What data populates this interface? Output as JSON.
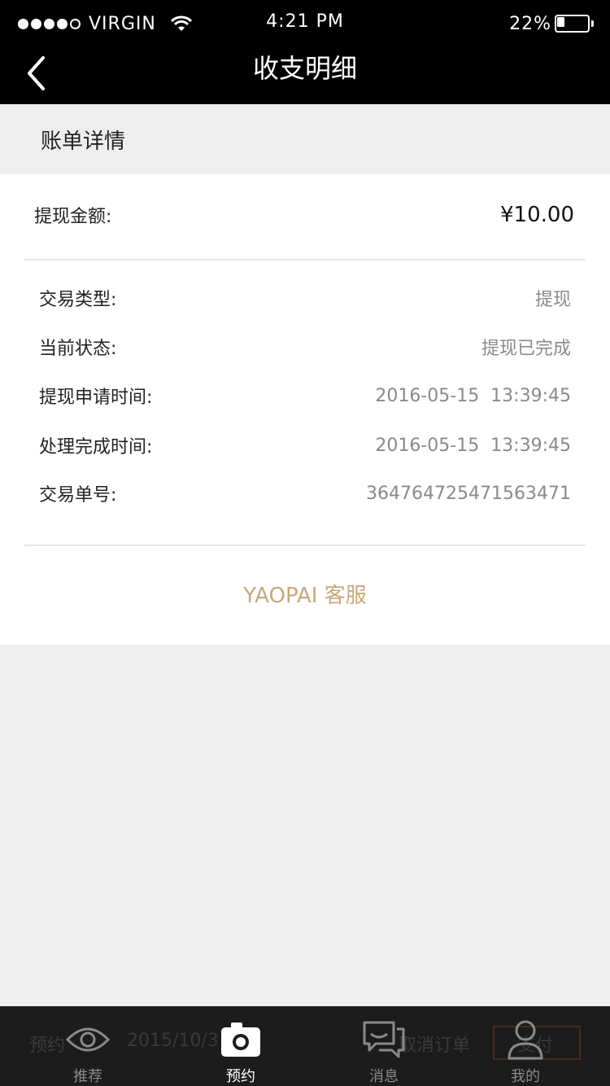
{
  "status_bar": {
    "carrier": "VIRGIN",
    "time": "4:21 PM",
    "battery": "22%"
  },
  "nav": {
    "title": "收支明细",
    "back_icon": "chevron-left-icon"
  },
  "section": {
    "title": "账单详情"
  },
  "amount": {
    "label": "提现金额:",
    "value": "¥10.00"
  },
  "details": [
    {
      "label": "交易类型:",
      "value": "提现"
    },
    {
      "label": "当前状态:",
      "value": "提现已完成"
    },
    {
      "label": "提现申请时间:",
      "value": "2016-05-15  13:39:45"
    },
    {
      "label": "处理完成时间:",
      "value": "2016-05-15  13:39:45"
    },
    {
      "label": "交易单号:",
      "value": "364764725471563471"
    }
  ],
  "service": {
    "label": "YAOPAI 客服"
  },
  "tabbar": {
    "background_text": {
      "left": "预约",
      "date": "2015/10/3",
      "cancel": "取消订单",
      "pay": "支付"
    },
    "tabs": [
      {
        "label": "推荐",
        "icon": "eye-icon"
      },
      {
        "label": "预约",
        "icon": "camera-icon",
        "active": true
      },
      {
        "label": "消息",
        "icon": "chat-bubbles-icon"
      },
      {
        "label": "我的",
        "icon": "person-icon"
      }
    ]
  },
  "colors": {
    "nav_background": "#000000",
    "accent_gold": "#c8a878",
    "page_background": "#eeeeee",
    "tabbar_background": "#1c1c1c"
  }
}
